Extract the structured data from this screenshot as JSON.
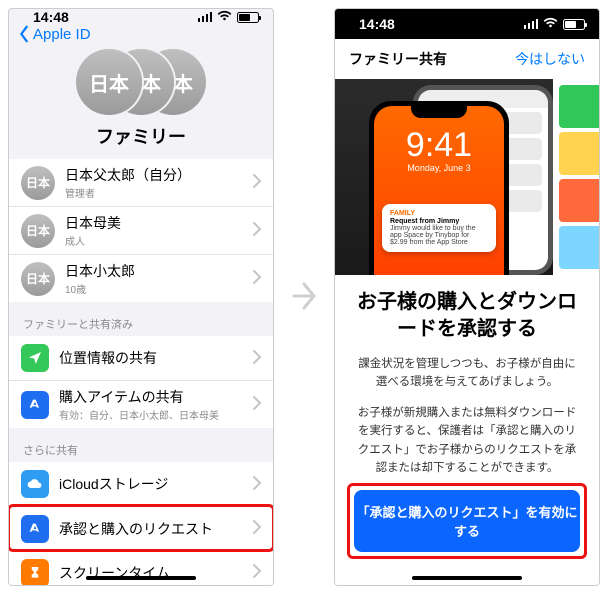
{
  "status": {
    "time": "14:48"
  },
  "left": {
    "back_label": "Apple ID",
    "hero_badge": "日本",
    "hero_title": "ファミリー",
    "members": [
      {
        "badge": "日本",
        "name": "日本父太郎（自分）",
        "role": "管理者"
      },
      {
        "badge": "日本",
        "name": "日本母美",
        "role": "成人"
      },
      {
        "badge": "日本",
        "name": "日本小太郎",
        "role": "10歳"
      }
    ],
    "section_shared": "ファミリーと共有済み",
    "shared": [
      {
        "icon": "location",
        "label": "位置情報の共有"
      },
      {
        "icon": "appstore",
        "label": "購入アイテムの共有",
        "sub": "有効：自分、日本小太郎、日本母美"
      }
    ],
    "section_more": "さらに共有",
    "more": [
      {
        "icon": "cloud",
        "label": "iCloudストレージ"
      },
      {
        "icon": "appstore",
        "label": "承認と購入のリクエスト",
        "hl": true
      },
      {
        "icon": "hourglass",
        "label": "スクリーンタイム"
      }
    ]
  },
  "right": {
    "modal_title": "ファミリー共有",
    "skip": "今はしない",
    "lock_time": "9:41",
    "lock_date": "Monday, June 3",
    "notif_app": "FAMILY",
    "notif_title": "Request from Jimmy",
    "notif_body": "Jimmy would like to buy the app Space by Tinybop for $2.99 from the App Store",
    "heading": "お子様の購入とダウンロードを承認する",
    "para1": "課金状況を管理しつつも、お子様が自由に選べる環境を与えてあげましょう。",
    "para2": "お子様が新規購入または無料ダウンロードを実行すると、保護者は「承認と購入のリクエスト」でお子様からのリクエストを承認または却下することができます。",
    "cta": "「承認と購入のリクエスト」を有効にする"
  }
}
